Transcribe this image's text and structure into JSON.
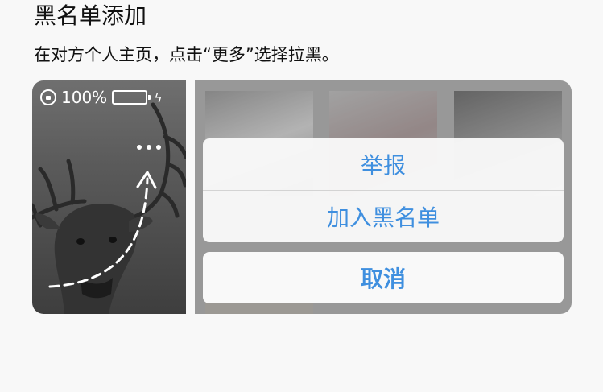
{
  "header": {
    "title": "黑名单添加",
    "subtitle": "在对方个人主页，点击“更多”选择拉黑。"
  },
  "phone_status": {
    "battery_percent": "100%",
    "battery_level": 1.0,
    "battery_color": "#4cd964"
  },
  "action_sheet": {
    "items": [
      {
        "label": "举报"
      },
      {
        "label": "加入黑名单"
      }
    ],
    "cancel_label": "取消",
    "accent_color": "#3f8fdf"
  },
  "icons": {
    "rotation_lock": "rotation-lock-icon",
    "battery": "battery-icon",
    "charging": "charging-bolt-icon",
    "more": "more-dots-icon",
    "gesture_arrow": "dashed-arrow-icon"
  }
}
